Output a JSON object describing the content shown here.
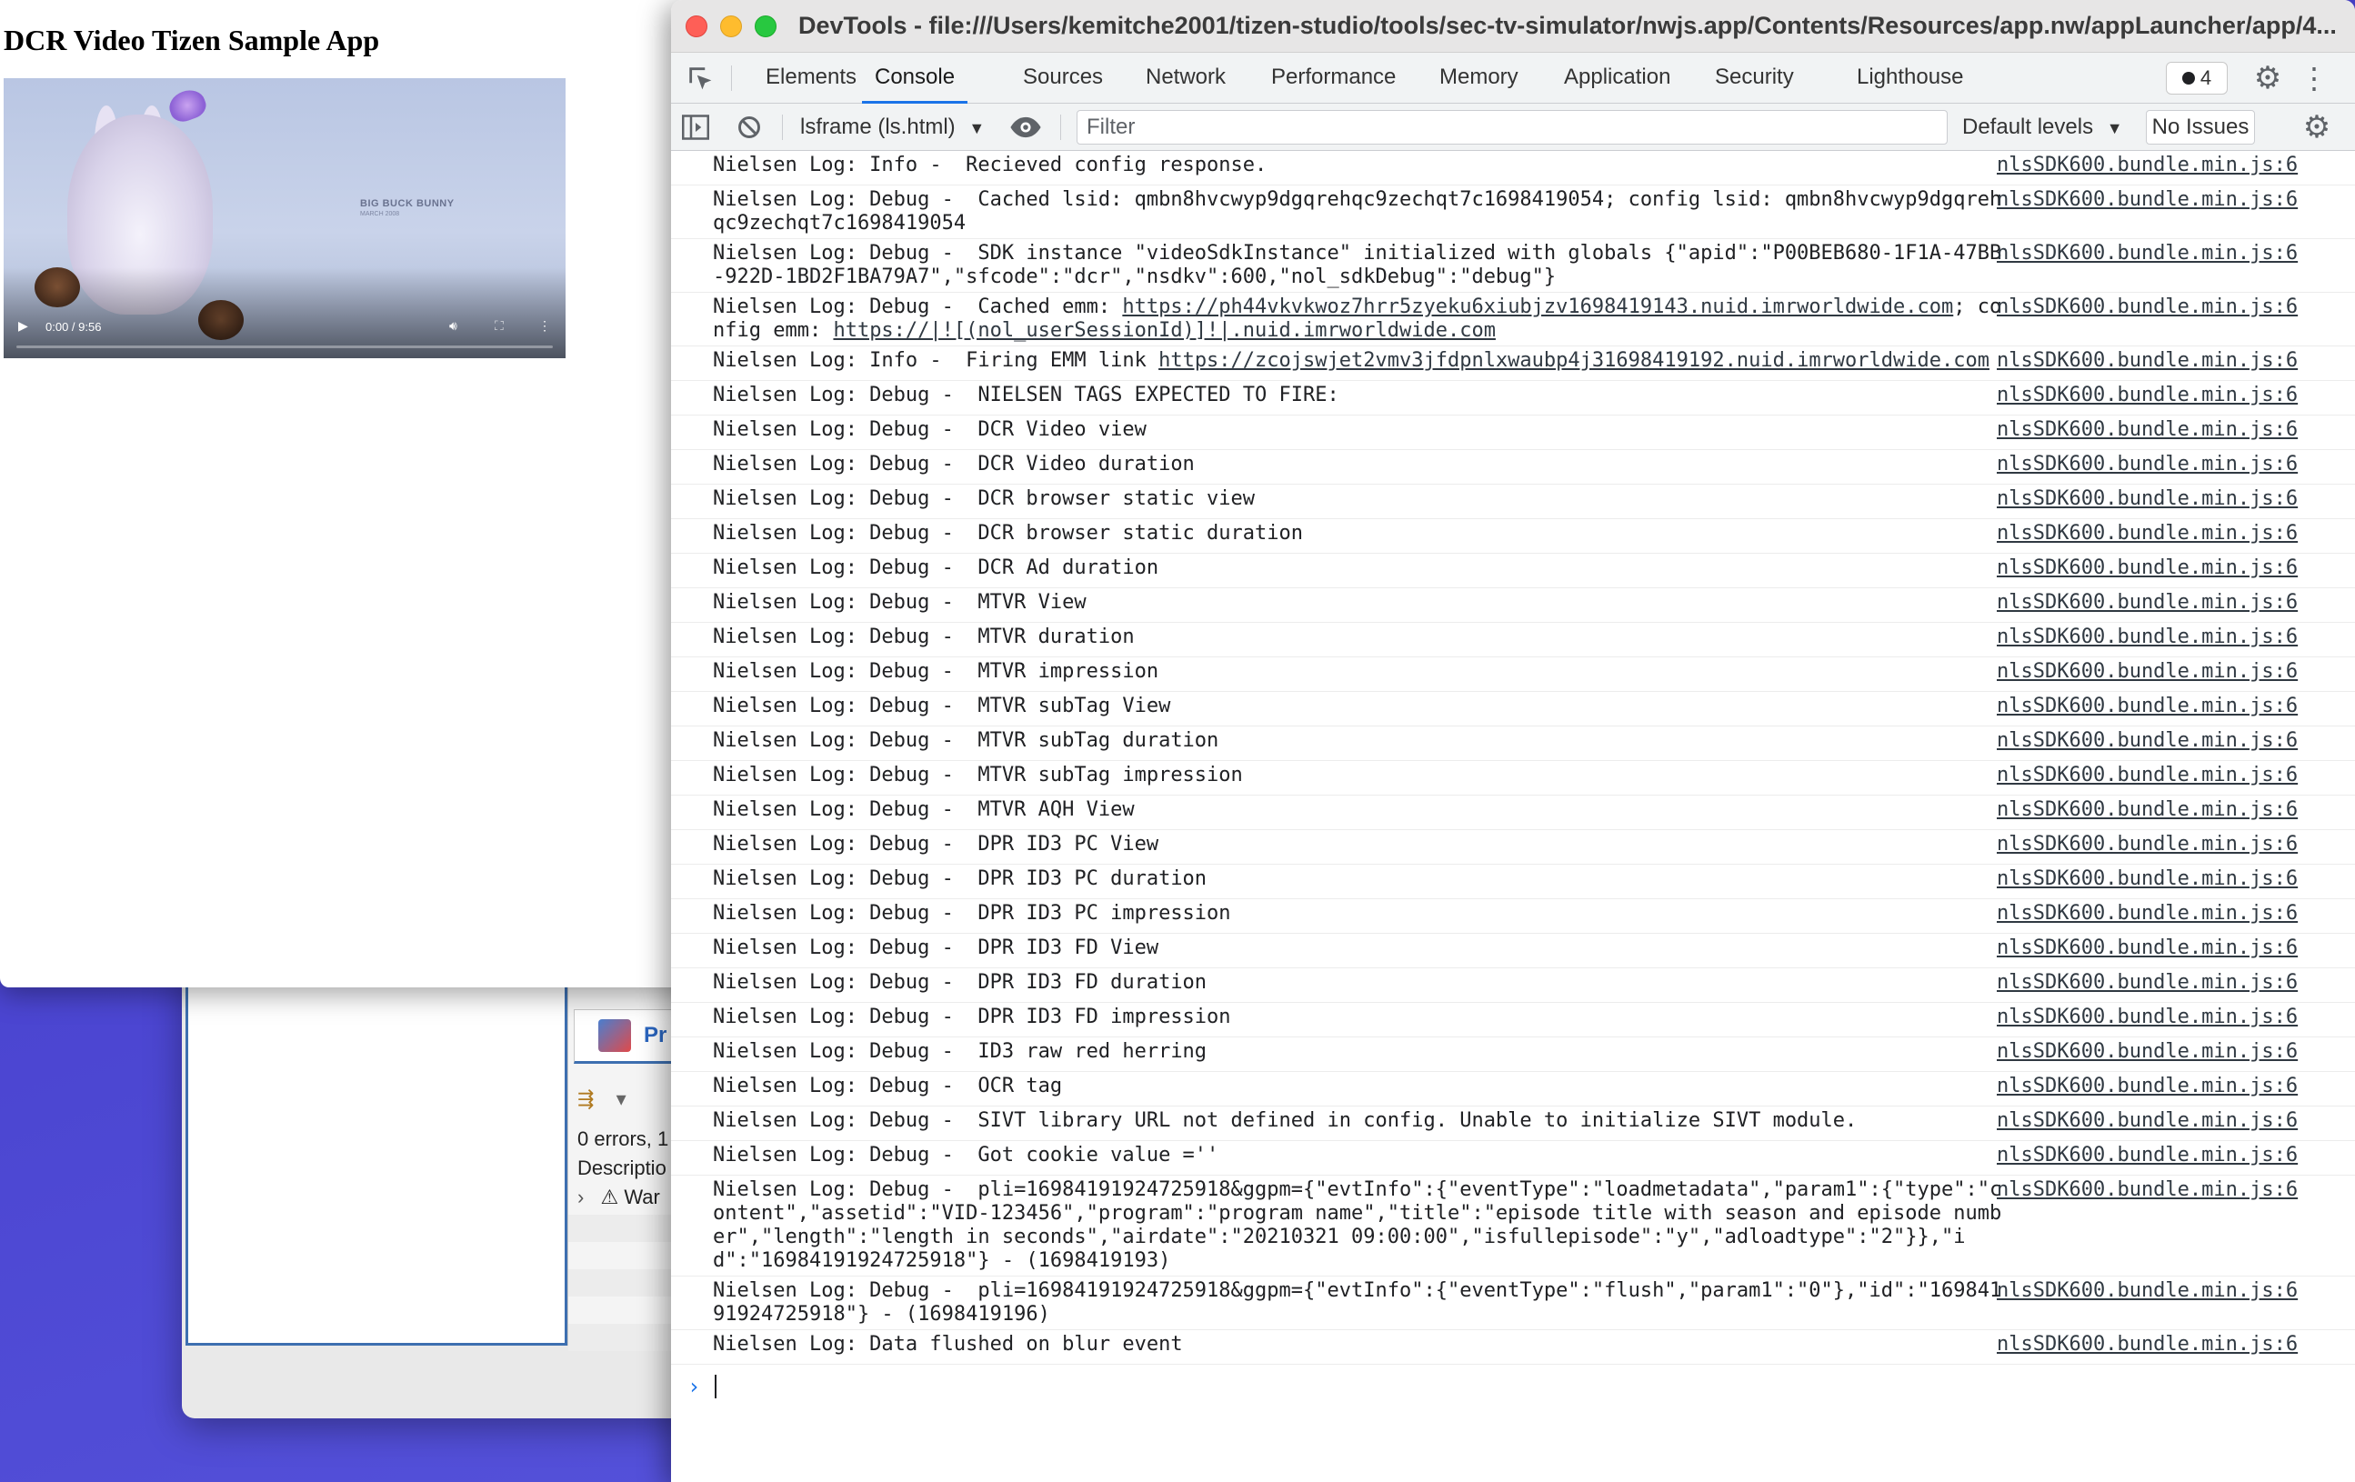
{
  "app": {
    "title": "DCR Video Tizen Sample App",
    "video": {
      "brand": "BIG BUCK BUNNY",
      "brand_sub": "MARCH 2008",
      "time": "0:00 / 9:56"
    }
  },
  "ide": {
    "tab_label": "Pr",
    "errors_text": "0 errors, 1",
    "description_header": "Descriptio",
    "warning_row": "War"
  },
  "devtools": {
    "window_title": "DevTools - file:///Users/kemitche2001/tizen-studio/tools/sec-tv-simulator/nwjs.app/Contents/Resources/app.nw/appLauncher/app/4...",
    "tabs": [
      "Elements",
      "Console",
      "Sources",
      "Network",
      "Performance",
      "Memory",
      "Application",
      "Security",
      "Lighthouse"
    ],
    "active_tab": "Console",
    "issues_count": "4",
    "toolbar": {
      "context": "lsframe (ls.html)",
      "filter_placeholder": "Filter",
      "levels": "Default levels",
      "no_issues": "No Issues"
    },
    "console": {
      "logs": [
        {
          "segments": [
            {
              "t": "Nielsen Log: Info -  Recieved config response."
            }
          ],
          "source": "nlsSDK600.bundle.min.js:6"
        },
        {
          "segments": [
            {
              "t": "Nielsen Log: Debug -  Cached lsid: qmbn8hvcwyp9dgqrehqc9zechqt7c1698419054; config lsid: qmbn8hvcwyp9dgqrehqc9zechqt7c1698419054"
            }
          ],
          "source": "nlsSDK600.bundle.min.js:6"
        },
        {
          "segments": [
            {
              "t": "Nielsen Log: Debug -  SDK instance \"videoSdkInstance\" initialized with globals {\"apid\":\"P00BEB680-1F1A-47BB-922D-1BD2F1BA79A7\",\"sfcode\":\"dcr\",\"nsdkv\":600,\"nol_sdkDebug\":\"debug\"}"
            }
          ],
          "source": "nlsSDK600.bundle.min.js:6"
        },
        {
          "segments": [
            {
              "t": "Nielsen Log: Debug -  Cached emm: "
            },
            {
              "t": "https://ph44vkvkwoz7hrr5zyeku6xiubjzv1698419143.nuid.imrworldwide.com",
              "link": true
            },
            {
              "t": "; config emm: "
            },
            {
              "t": "https://|![(nol_userSessionId)]!|.nuid.imrworldwide.com",
              "link": true
            }
          ],
          "source": "nlsSDK600.bundle.min.js:6"
        },
        {
          "segments": [
            {
              "t": "Nielsen Log: Info -  Firing EMM link "
            },
            {
              "t": "https://zcojswjet2vmv3jfdpnlxwaubp4j31698419192.nuid.imrworldwide.com",
              "link": true
            }
          ],
          "source": "nlsSDK600.bundle.min.js:6"
        },
        {
          "segments": [
            {
              "t": "Nielsen Log: Debug -  NIELSEN TAGS EXPECTED TO FIRE:"
            }
          ],
          "source": "nlsSDK600.bundle.min.js:6"
        },
        {
          "segments": [
            {
              "t": "Nielsen Log: Debug -  DCR Video view"
            }
          ],
          "source": "nlsSDK600.bundle.min.js:6"
        },
        {
          "segments": [
            {
              "t": "Nielsen Log: Debug -  DCR Video duration"
            }
          ],
          "source": "nlsSDK600.bundle.min.js:6"
        },
        {
          "segments": [
            {
              "t": "Nielsen Log: Debug -  DCR browser static view"
            }
          ],
          "source": "nlsSDK600.bundle.min.js:6"
        },
        {
          "segments": [
            {
              "t": "Nielsen Log: Debug -  DCR browser static duration"
            }
          ],
          "source": "nlsSDK600.bundle.min.js:6"
        },
        {
          "segments": [
            {
              "t": "Nielsen Log: Debug -  DCR Ad duration"
            }
          ],
          "source": "nlsSDK600.bundle.min.js:6"
        },
        {
          "segments": [
            {
              "t": "Nielsen Log: Debug -  MTVR View"
            }
          ],
          "source": "nlsSDK600.bundle.min.js:6"
        },
        {
          "segments": [
            {
              "t": "Nielsen Log: Debug -  MTVR duration"
            }
          ],
          "source": "nlsSDK600.bundle.min.js:6"
        },
        {
          "segments": [
            {
              "t": "Nielsen Log: Debug -  MTVR impression"
            }
          ],
          "source": "nlsSDK600.bundle.min.js:6"
        },
        {
          "segments": [
            {
              "t": "Nielsen Log: Debug -  MTVR subTag View"
            }
          ],
          "source": "nlsSDK600.bundle.min.js:6"
        },
        {
          "segments": [
            {
              "t": "Nielsen Log: Debug -  MTVR subTag duration"
            }
          ],
          "source": "nlsSDK600.bundle.min.js:6"
        },
        {
          "segments": [
            {
              "t": "Nielsen Log: Debug -  MTVR subTag impression"
            }
          ],
          "source": "nlsSDK600.bundle.min.js:6"
        },
        {
          "segments": [
            {
              "t": "Nielsen Log: Debug -  MTVR AQH View"
            }
          ],
          "source": "nlsSDK600.bundle.min.js:6"
        },
        {
          "segments": [
            {
              "t": "Nielsen Log: Debug -  DPR ID3 PC View"
            }
          ],
          "source": "nlsSDK600.bundle.min.js:6"
        },
        {
          "segments": [
            {
              "t": "Nielsen Log: Debug -  DPR ID3 PC duration"
            }
          ],
          "source": "nlsSDK600.bundle.min.js:6"
        },
        {
          "segments": [
            {
              "t": "Nielsen Log: Debug -  DPR ID3 PC impression"
            }
          ],
          "source": "nlsSDK600.bundle.min.js:6"
        },
        {
          "segments": [
            {
              "t": "Nielsen Log: Debug -  DPR ID3 FD View"
            }
          ],
          "source": "nlsSDK600.bundle.min.js:6"
        },
        {
          "segments": [
            {
              "t": "Nielsen Log: Debug -  DPR ID3 FD duration"
            }
          ],
          "source": "nlsSDK600.bundle.min.js:6"
        },
        {
          "segments": [
            {
              "t": "Nielsen Log: Debug -  DPR ID3 FD impression"
            }
          ],
          "source": "nlsSDK600.bundle.min.js:6"
        },
        {
          "segments": [
            {
              "t": "Nielsen Log: Debug -  ID3 raw red herring"
            }
          ],
          "source": "nlsSDK600.bundle.min.js:6"
        },
        {
          "segments": [
            {
              "t": "Nielsen Log: Debug -  OCR tag"
            }
          ],
          "source": "nlsSDK600.bundle.min.js:6"
        },
        {
          "segments": [
            {
              "t": "Nielsen Log: Debug -  SIVT library URL not defined in config. Unable to initialize SIVT module."
            }
          ],
          "source": "nlsSDK600.bundle.min.js:6"
        },
        {
          "segments": [
            {
              "t": "Nielsen Log: Debug -  Got cookie value =''"
            }
          ],
          "source": "nlsSDK600.bundle.min.js:6"
        },
        {
          "segments": [
            {
              "t": "Nielsen Log: Debug -  pli=16984191924725918&ggpm={\"evtInfo\":{\"eventType\":\"loadmetadata\",\"param1\":{\"type\":\"content\",\"assetid\":\"VID-123456\",\"program\":\"program name\",\"title\":\"episode title with season and episode number\",\"length\":\"length in seconds\",\"airdate\":\"20210321 09:00:00\",\"isfullepisode\":\"y\",\"adloadtype\":\"2\"}},\"id\":\"16984191924725918\"} - (1698419193)"
            }
          ],
          "source": "nlsSDK600.bundle.min.js:6"
        },
        {
          "segments": [
            {
              "t": "Nielsen Log: Debug -  pli=16984191924725918&ggpm={\"evtInfo\":{\"eventType\":\"flush\",\"param1\":\"0\"},\"id\":\"16984191924725918\"} - (1698419196)"
            }
          ],
          "source": "nlsSDK600.bundle.min.js:6"
        },
        {
          "segments": [
            {
              "t": "Nielsen Log: Data flushed on blur event"
            }
          ],
          "source": "nlsSDK600.bundle.min.js:6"
        }
      ]
    }
  }
}
